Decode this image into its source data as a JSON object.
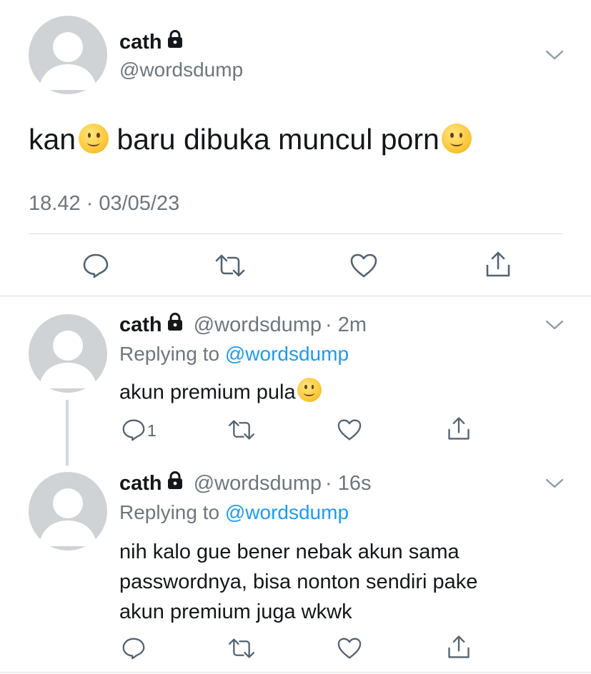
{
  "main_tweet": {
    "name": "cath",
    "handle": "@wordsdump",
    "text": "kan",
    "text_after": " baru dibuka muncul porn",
    "timestamp": "18.42 · 03/05/23"
  },
  "replies": [
    {
      "name": "cath",
      "handle": "@wordsdump",
      "time": "· 2m",
      "replying_prefix": "Replying to ",
      "replying_handle": "@wordsdump",
      "text": "akun premium pula",
      "reply_count": "1"
    },
    {
      "name": "cath",
      "handle": "@wordsdump",
      "time": "· 16s",
      "replying_prefix": "Replying to ",
      "replying_handle": "@wordsdump",
      "text_lines": [
        "nih kalo gue bener nebak akun sama",
        "passwordnya, bisa nonton sendiri pake",
        "akun premium juga wkwk"
      ]
    }
  ],
  "icons": {
    "lock": "lock-icon",
    "chevron": "chevron-down-icon",
    "reply": "reply-icon",
    "retweet": "retweet-icon",
    "like": "heart-icon",
    "share": "share-icon",
    "emoji": "slightly-smiling-face-emoji"
  },
  "colors": {
    "text": "#14171a",
    "secondary": "#6e767d",
    "link": "#1d9bf0",
    "divider": "#d9dde0",
    "avatar_bg": "#cfd3d6"
  }
}
